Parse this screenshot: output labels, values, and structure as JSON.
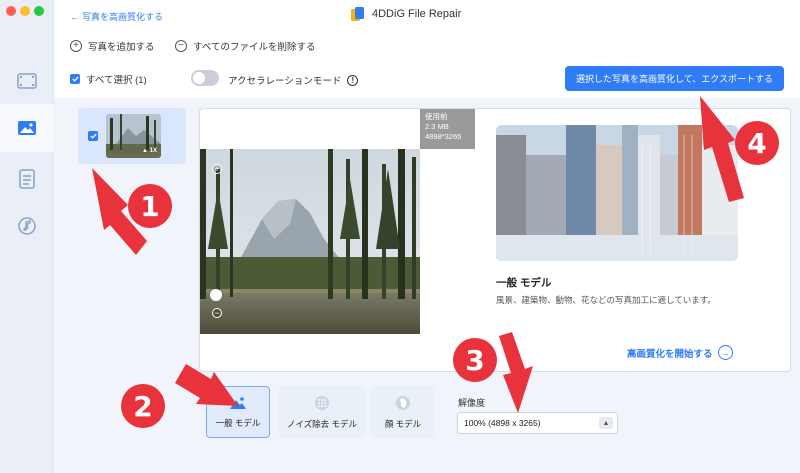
{
  "app": {
    "title": "4DDiG File Repair",
    "back_label": "写真を高画質化する"
  },
  "toolbar": {
    "add_photos": "写真を追加する",
    "remove_all": "すべてのファイルを削除する"
  },
  "selection": {
    "select_all": "すべて選択 (1)",
    "accel_mode": "アクセラレーションモード",
    "accel_enabled": false
  },
  "export_button": "選択した写真を高画質化して、エクスポートする",
  "thumbnail": {
    "badge": "1X",
    "checked": true
  },
  "preview": {
    "meta_label": "使用前",
    "meta_size": "2.3 MB",
    "meta_dims": "4898*3265"
  },
  "model_info": {
    "title": "一般 モデル",
    "description": "風景、建築物、動物、花などの写真加工に適しています。",
    "start_label": "高画質化を開始する"
  },
  "models": [
    {
      "label": "一般 モデル",
      "icon": "mountain-icon",
      "selected": true
    },
    {
      "label": "ノイズ除去 モデル",
      "icon": "noise-icon",
      "selected": false
    },
    {
      "label": "顔 モデル",
      "icon": "face-icon",
      "selected": false
    }
  ],
  "resolution": {
    "label": "解像度",
    "value": "100% (4898 x 3265)"
  },
  "annotations": [
    "1",
    "2",
    "3",
    "4"
  ],
  "colors": {
    "accent": "#2f7cf6",
    "annotation": "#e8323c"
  }
}
